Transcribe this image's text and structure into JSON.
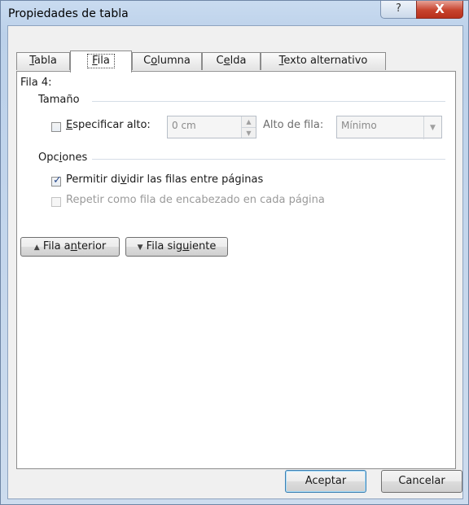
{
  "window": {
    "title": "Propiedades de tabla",
    "help_label": "?",
    "close_label": "X"
  },
  "tabs": [
    {
      "label": "Tabla",
      "mnemonic": "T",
      "rest": "abla"
    },
    {
      "label": "Fila",
      "mnemonic": "F",
      "rest": "ila"
    },
    {
      "label": "Columna",
      "pre": "C",
      "mnemonic": "o",
      "rest": "lumna"
    },
    {
      "label": "Celda",
      "pre": "C",
      "mnemonic": "e",
      "rest": "lda"
    },
    {
      "label": "Texto alternativo",
      "mnemonic": "T",
      "rest": "exto alternativo"
    }
  ],
  "active_tab": "Fila",
  "panel": {
    "row_heading": "Fila 4:",
    "size_section": "Tamaño",
    "specify_height": {
      "mnemonic": "E",
      "rest": "specificar alto:",
      "checked": false
    },
    "height_value": "0 cm",
    "row_height_label": "Alto de fila:",
    "row_height_value": "Mínimo",
    "options_section": {
      "pre": "Opc",
      "mnemonic": "i",
      "rest": "ones"
    },
    "allow_split": {
      "pre": "Permitir di",
      "mnemonic": "v",
      "rest": "idir las filas entre páginas",
      "checked": true
    },
    "repeat_header": {
      "label": "Repetir como fila de encabezado en cada página",
      "checked": false,
      "enabled": false
    },
    "prev_row": {
      "pre": "Fila a",
      "mnemonic": "n",
      "rest": "terior",
      "icon": "triangle-up"
    },
    "next_row": {
      "pre": "Fila sig",
      "mnemonic": "u",
      "rest": "iente",
      "icon": "triangle-down"
    }
  },
  "footer": {
    "ok_label": "Aceptar",
    "cancel_label": "Cancelar"
  }
}
